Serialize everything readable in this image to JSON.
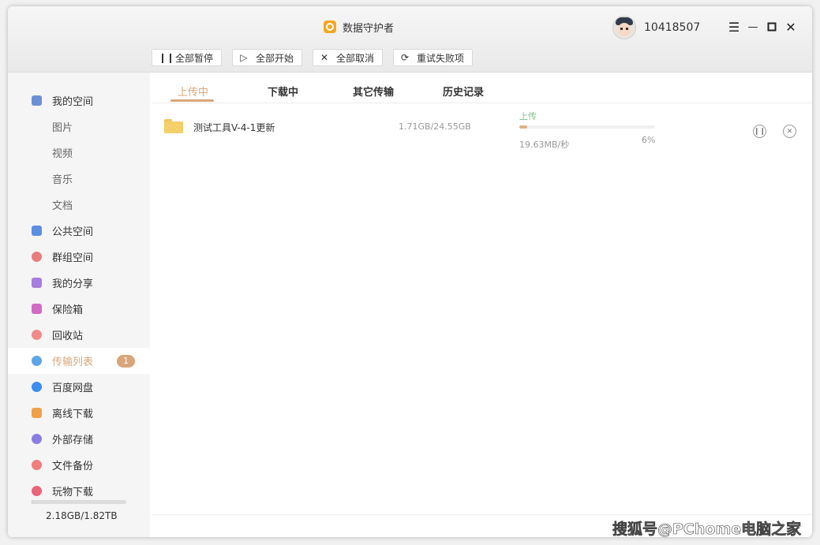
{
  "app": {
    "title": "数据守护者",
    "logo_icon": "app-logo-icon"
  },
  "user": {
    "id": "10418507"
  },
  "window_controls": {
    "menu": "☰",
    "minimize": "—",
    "maximize": "☐",
    "close": "✕"
  },
  "toolbar": {
    "pause_all": "全部暂停",
    "start_all": "全部开始",
    "cancel_all": "全部取消",
    "retry_failed": "重试失败项"
  },
  "sidebar": {
    "items": [
      {
        "label": "我的空间",
        "color": "#6b8fd6"
      },
      {
        "label": "图片"
      },
      {
        "label": "视频"
      },
      {
        "label": "音乐"
      },
      {
        "label": "文档"
      },
      {
        "label": "公共空间",
        "color": "#5b8fe0"
      },
      {
        "label": "群组空间",
        "color": "#e87d7d"
      },
      {
        "label": "我的分享",
        "color": "#a77de0"
      },
      {
        "label": "保险箱",
        "color": "#d06bc6"
      },
      {
        "label": "回收站",
        "color": "#f08a8a"
      },
      {
        "label": "传输列表",
        "color": "#5fa6e8",
        "badge": "1"
      },
      {
        "label": "百度网盘",
        "color": "#3d8cf0"
      },
      {
        "label": "离线下载",
        "color": "#f0a04b"
      },
      {
        "label": "外部存储",
        "color": "#8a7de0"
      },
      {
        "label": "文件备份",
        "color": "#f07d7d"
      },
      {
        "label": "玩物下载",
        "color": "#e8657a"
      }
    ],
    "storage": {
      "text": "2.18GB/1.82TB",
      "used_fraction": 0.001
    }
  },
  "tabs": [
    {
      "label": "上传中"
    },
    {
      "label": "下载中"
    },
    {
      "label": "其它传输"
    },
    {
      "label": "历史记录"
    }
  ],
  "transfer": {
    "name": "测试工具V-4-1更新",
    "size": "1.71GB/24.55GB",
    "status": "上传",
    "speed": "19.63MB/秒",
    "percent_text": "6%",
    "percent": 6
  },
  "watermark": "搜狐号@PChome电脑之家"
}
